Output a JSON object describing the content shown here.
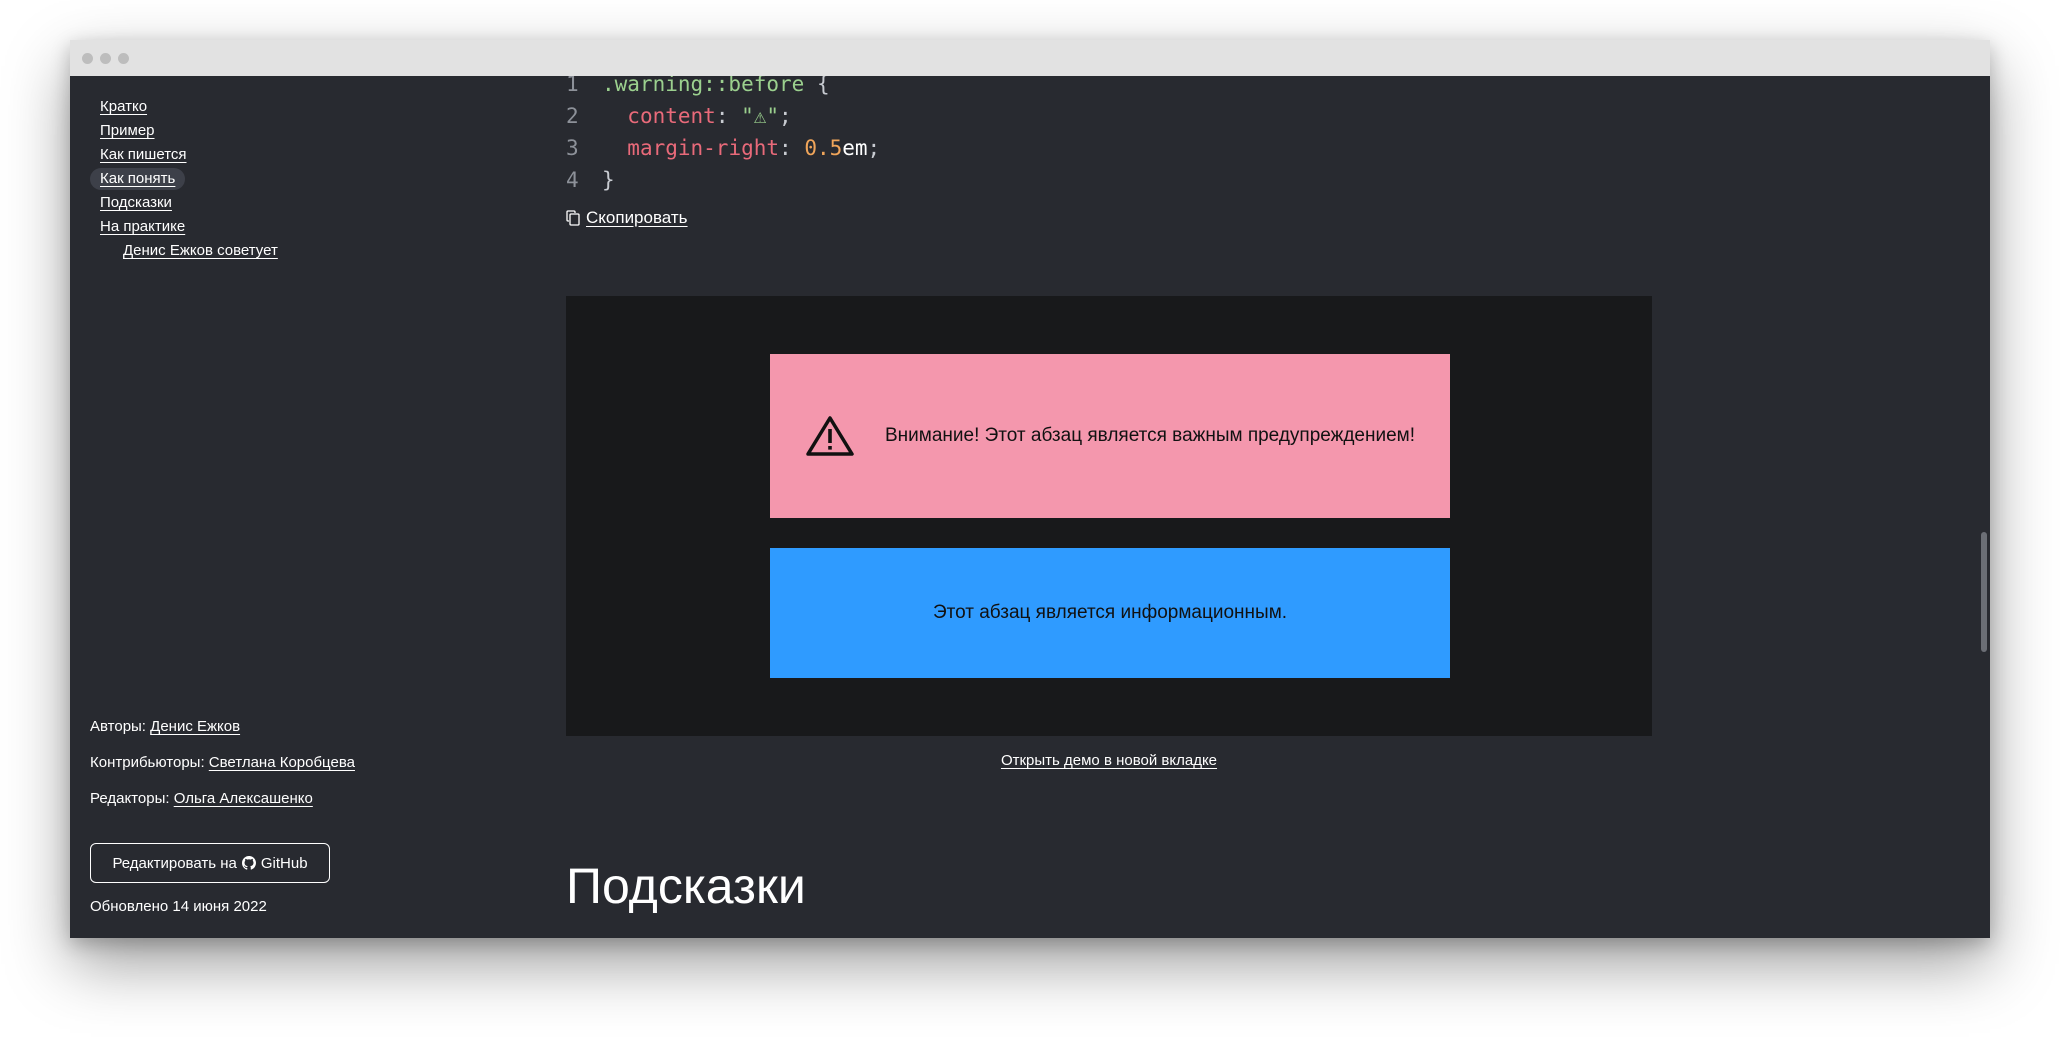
{
  "toc": {
    "items": [
      {
        "label": "Кратко"
      },
      {
        "label": "Пример"
      },
      {
        "label": "Как пишется"
      },
      {
        "label": "Как понять"
      },
      {
        "label": "Подсказки"
      },
      {
        "label": "На практике"
      },
      {
        "label": "Денис Ежков советует"
      }
    ],
    "active": "Как понять"
  },
  "meta": {
    "authors_label": "Авторы:",
    "authors": "Денис Ежков",
    "contributors_label": "Контрибьюторы:",
    "contributors": "Светлана Коробцева",
    "editors_label": "Редакторы:",
    "editors": "Ольга Алексашенко",
    "edit_button": "Редактировать на",
    "edit_button_service": "GitHub",
    "updated": "Обновлено 14 июня 2022"
  },
  "code": {
    "lines": [
      {
        "n": "1",
        "selector": ".warning::before",
        "brace": " {"
      },
      {
        "n": "2",
        "prop": "content",
        "colon": ": ",
        "string": "\"⚠\"",
        "semi": ";"
      },
      {
        "n": "3",
        "prop": "margin-right",
        "colon": ": ",
        "num": "0.5",
        "unit": "em",
        "semi": ";"
      },
      {
        "n": "4",
        "close": "}"
      }
    ],
    "copy_label": "Скопировать"
  },
  "demo": {
    "warning_text": "Внимание! Этот абзац является важным предупреждением!",
    "info_text": "Этот абзац является информационным.",
    "open_link": "Открыть демо в новой вкладке"
  },
  "section": {
    "title": "Подсказки"
  },
  "colors": {
    "page_bg": "#282a30",
    "demo_bg": "#18191b",
    "warning_bg": "#f497ad",
    "info_bg": "#2f9bff"
  }
}
